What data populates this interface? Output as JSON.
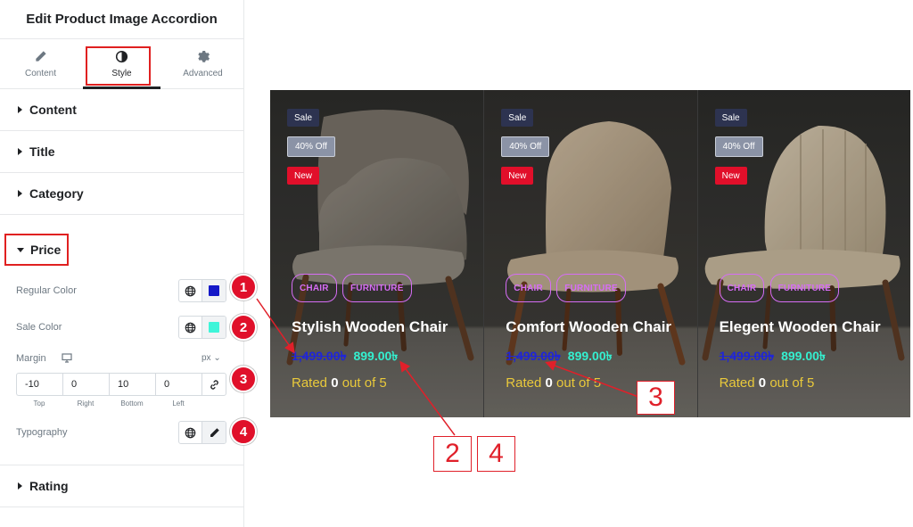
{
  "panel": {
    "title": "Edit Product Image Accordion",
    "tabs": [
      {
        "label": "Content",
        "icon": "pencil-icon"
      },
      {
        "label": "Style",
        "icon": "contrast-icon"
      },
      {
        "label": "Advanced",
        "icon": "gear-icon"
      }
    ],
    "sections": [
      "Content",
      "Title",
      "Category",
      "Price",
      "Rating"
    ],
    "price": {
      "regular_color_label": "Regular Color",
      "regular_color": "#1418c8",
      "sale_color_label": "Sale Color",
      "sale_color": "#3ef5d9",
      "margin_label": "Margin",
      "margin_unit": "px",
      "margin_values": [
        "-10",
        "0",
        "10",
        "0"
      ],
      "margin_sides": [
        "Top",
        "Right",
        "Bottom",
        "Left"
      ],
      "typography_label": "Typography"
    },
    "markers": [
      "1",
      "2",
      "3",
      "4"
    ]
  },
  "products": [
    {
      "badges": [
        "Sale",
        "40% Off",
        "New"
      ],
      "tags": [
        "CHAIR",
        "FURNITURE"
      ],
      "title": "Stylish Wooden Chair",
      "regular_price": "1,499.00৳",
      "sale_price": "899.00৳",
      "rating_prefix": "Rated",
      "rating_value": "0",
      "rating_suffix": "out of 5"
    },
    {
      "badges": [
        "Sale",
        "40% Off",
        "New"
      ],
      "tags": [
        "CHAIR",
        "FURNITURE"
      ],
      "title": "Comfort Wooden Chair",
      "regular_price": "1,499.00৳",
      "sale_price": "899.00৳",
      "rating_prefix": "Rated",
      "rating_value": "0",
      "rating_suffix": "out of 5"
    },
    {
      "badges": [
        "Sale",
        "40% Off",
        "New"
      ],
      "tags": [
        "CHAIR",
        "FURNITURE"
      ],
      "title": "Elegent Wooden Chair",
      "regular_price": "1,499.00৳",
      "sale_price": "899.00৳",
      "rating_prefix": "Rated",
      "rating_value": "0",
      "rating_suffix": "out of 5"
    }
  ],
  "annotations": [
    "3",
    "2",
    "4"
  ]
}
